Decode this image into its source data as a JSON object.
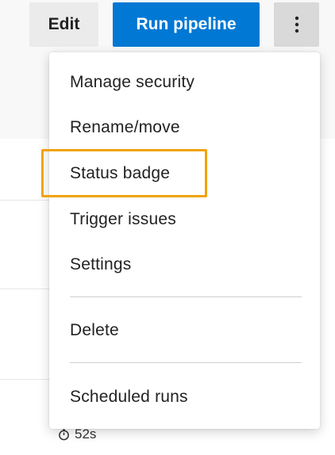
{
  "toolbar": {
    "edit_label": "Edit",
    "run_label": "Run pipeline",
    "more_icon": "more-vertical-icon"
  },
  "menu": {
    "items": [
      {
        "label": "Manage security"
      },
      {
        "label": "Rename/move"
      },
      {
        "label": "Status badge",
        "highlighted": true
      },
      {
        "label": "Trigger issues"
      },
      {
        "label": "Settings"
      },
      {
        "label": "Delete"
      },
      {
        "label": "Scheduled runs"
      }
    ]
  },
  "background": {
    "duration": "52s",
    "duration_icon": "clock-icon"
  },
  "colors": {
    "primary": "#0078d4",
    "highlight": "#f0a30a"
  }
}
